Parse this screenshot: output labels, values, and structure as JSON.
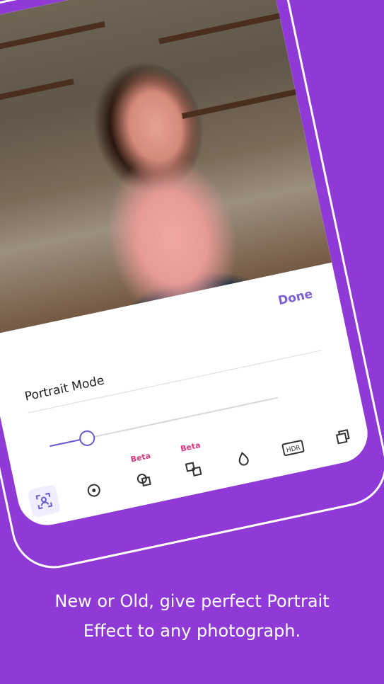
{
  "panel": {
    "done_label": "Done",
    "title": "Portrait Mode",
    "slider_value": 0.16
  },
  "toolbar": {
    "beta_label_1": "Beta",
    "beta_label_2": "Beta",
    "hdr_label": "HDR"
  },
  "caption": {
    "line1": "New or Old, give perfect Portrait",
    "line2": "Effect to any photograph."
  },
  "colors": {
    "background": "#8f3ad6",
    "accent": "#6a59d0",
    "done": "#7b5ed6",
    "beta": "#d83a7f"
  }
}
